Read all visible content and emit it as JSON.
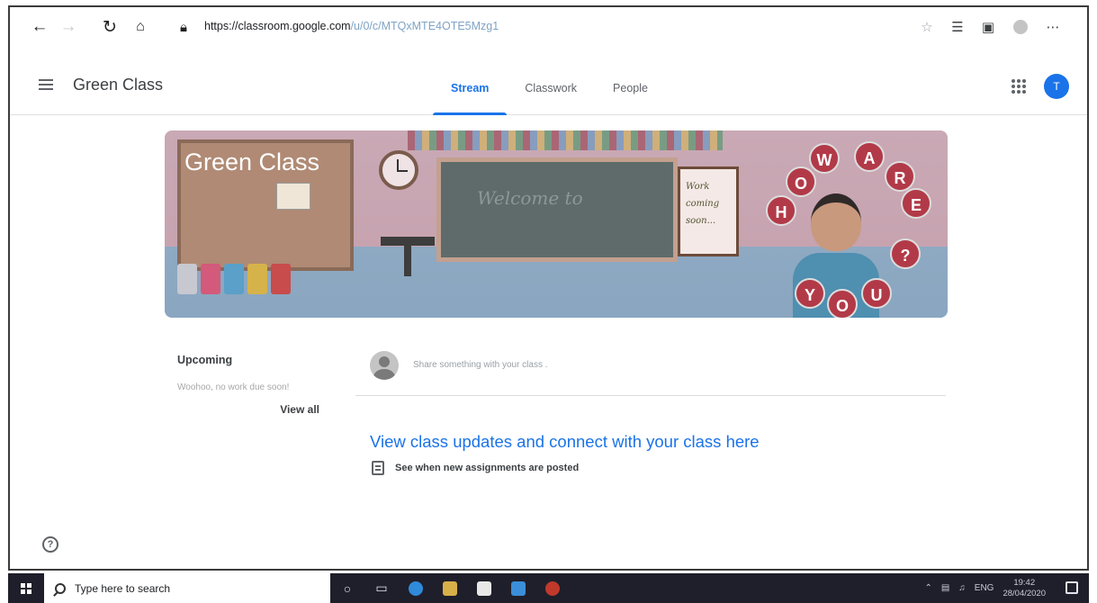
{
  "browser": {
    "url_host": "https://classroom.google.com",
    "url_path": "/u/0/c/MTQxMTE4OTE5Mzg1",
    "back_icon": "back-arrow-icon",
    "refresh_icon": "refresh-icon",
    "home_icon": "home-icon"
  },
  "header": {
    "class_name": "Green Class",
    "tabs": [
      {
        "label": "Stream",
        "active": true
      },
      {
        "label": "Classwork",
        "active": false
      },
      {
        "label": "People",
        "active": false
      }
    ],
    "avatar_initial": "T"
  },
  "banner": {
    "title": "Green Class",
    "chalkboard_text": "Welcome to",
    "easel_lines": [
      "Work",
      "coming",
      "soon..."
    ],
    "bubble_letters": [
      "H",
      "O",
      "W",
      "A",
      "R",
      "E",
      "Y",
      "O",
      "U",
      "?"
    ]
  },
  "upcoming": {
    "title": "Upcoming",
    "message": "Woohoo, no work due soon!",
    "view_all": "View all"
  },
  "stream": {
    "share_placeholder": "Share something with your class .",
    "updates_heading": "View class updates and connect with your class here",
    "assignments_text": "See when new assignments are posted"
  },
  "help_label": "?",
  "taskbar": {
    "search_placeholder": "Type here to search",
    "tray_lang": "ENG",
    "time": "19:42",
    "date": "28/04/2020"
  },
  "colors": {
    "accent": "#1a73e8",
    "taskbar": "#1f1f2b"
  }
}
